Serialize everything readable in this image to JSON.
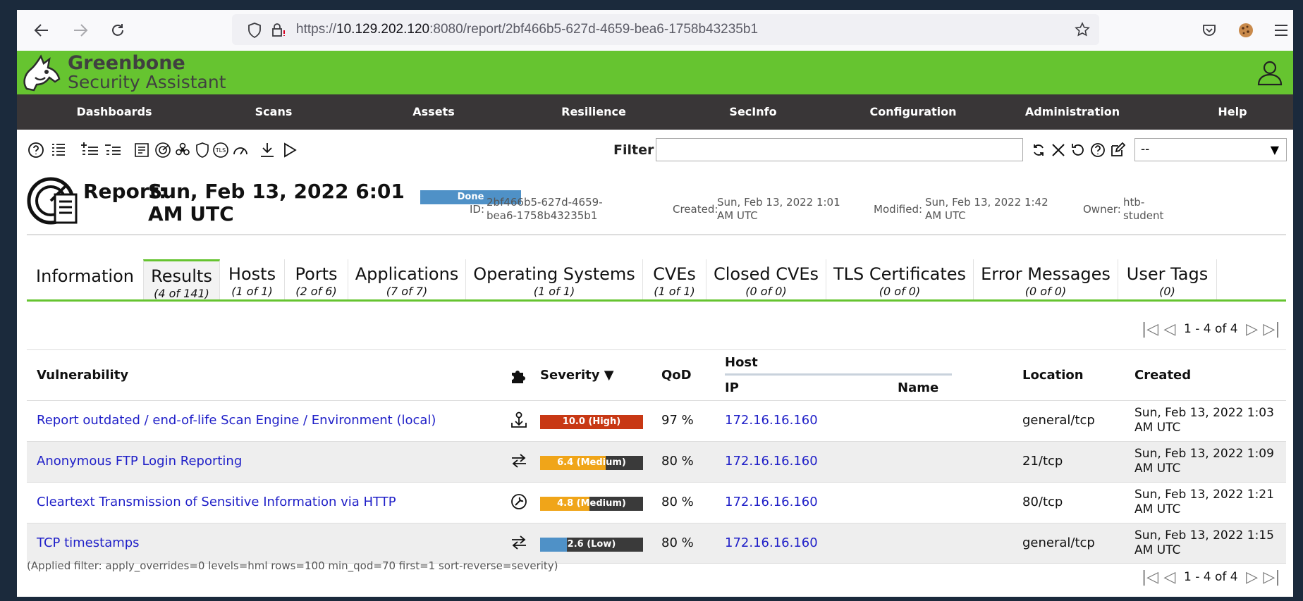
{
  "browser": {
    "url_scheme": "https://",
    "url_host": "10.129.202.120",
    "url_rest": ":8080/report/2bf466b5-627d-4659-bea6-1758b43235b1"
  },
  "header": {
    "brand_line1": "Greenbone",
    "brand_line2": "Security Assistant"
  },
  "menu": [
    "Dashboards",
    "Scans",
    "Assets",
    "Resilience",
    "SecInfo",
    "Configuration",
    "Administration",
    "Help"
  ],
  "toolbar": {
    "filter_label": "Filter",
    "filter_value": "",
    "select_value": "--"
  },
  "report": {
    "title_label": "Report:",
    "title_date": "Sun, Feb 13, 2022 6:01 AM UTC",
    "status": "Done",
    "id_label": "ID:",
    "id_value": "2bf466b5-627d-4659-bea6-1758b43235b1",
    "created_label": "Created:",
    "created_value": "Sun, Feb 13, 2022 1:01 AM UTC",
    "modified_label": "Modified:",
    "modified_value": "Sun, Feb 13, 2022 1:42 AM UTC",
    "owner_label": "Owner:",
    "owner_value": "htb-student"
  },
  "tabs": [
    {
      "label": "Information",
      "count": ""
    },
    {
      "label": "Results",
      "count": "(4 of 141)"
    },
    {
      "label": "Hosts",
      "count": "(1 of 1)"
    },
    {
      "label": "Ports",
      "count": "(2 of 6)"
    },
    {
      "label": "Applications",
      "count": "(7 of 7)"
    },
    {
      "label": "Operating Systems",
      "count": "(1 of 1)"
    },
    {
      "label": "CVEs",
      "count": "(1 of 1)"
    },
    {
      "label": "Closed CVEs",
      "count": "(0 of 0)"
    },
    {
      "label": "TLS Certificates",
      "count": "(0 of 0)"
    },
    {
      "label": "Error Messages",
      "count": "(0 of 0)"
    },
    {
      "label": "User Tags",
      "count": "(0)"
    }
  ],
  "pagination": {
    "text": "1 - 4 of 4"
  },
  "table": {
    "headers": {
      "vulnerability": "Vulnerability",
      "severity": "Severity ▼",
      "qod": "QoD",
      "host": "Host",
      "ip": "IP",
      "name": "Name",
      "location": "Location",
      "created": "Created"
    },
    "rows": [
      {
        "vulnerability": "Report outdated / end-of-life Scan Engine / Environment (local)",
        "solution_icon": "vendorfix-icon",
        "severity": 10.0,
        "severity_label": "10.0 (High)",
        "severity_color": "#c83814",
        "qod": "97 %",
        "ip": "172.16.16.160",
        "name": "",
        "location": "general/tcp",
        "created_line1": "Sun, Feb 13, 2022 1:03",
        "created_line2": "AM UTC"
      },
      {
        "vulnerability": "Anonymous FTP Login Reporting",
        "solution_icon": "mitigation-icon",
        "severity": 6.4,
        "severity_label": "6.4 (Medium)",
        "severity_color": "#f0a519",
        "qod": "80 %",
        "ip": "172.16.16.160",
        "name": "",
        "location": "21/tcp",
        "created_line1": "Sun, Feb 13, 2022 1:09",
        "created_line2": "AM UTC"
      },
      {
        "vulnerability": "Cleartext Transmission of Sensitive Information via HTTP",
        "solution_icon": "workaround-icon",
        "severity": 4.8,
        "severity_label": "4.8 (Medium)",
        "severity_color": "#f0a519",
        "qod": "80 %",
        "ip": "172.16.16.160",
        "name": "",
        "location": "80/tcp",
        "created_line1": "Sun, Feb 13, 2022 1:21",
        "created_line2": "AM UTC"
      },
      {
        "vulnerability": "TCP timestamps",
        "solution_icon": "mitigation-icon",
        "severity": 2.6,
        "severity_label": "2.6 (Low)",
        "severity_color": "#4f91c7",
        "qod": "80 %",
        "ip": "172.16.16.160",
        "name": "",
        "location": "general/tcp",
        "created_line1": "Sun, Feb 13, 2022 1:15",
        "created_line2": "AM UTC"
      }
    ]
  },
  "applied_filter": "(Applied filter: apply_overrides=0 levels=hml rows=100 min_qod=70 first=1 sort-reverse=severity)"
}
